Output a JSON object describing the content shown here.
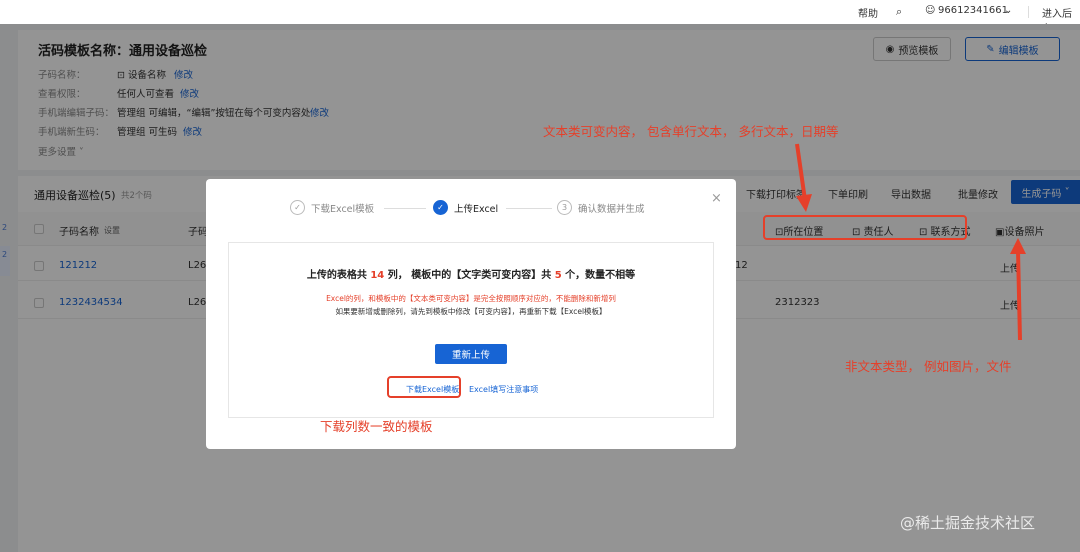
{
  "topbar": {
    "help": "帮助",
    "phone": "96612341661",
    "enter": "进入后台"
  },
  "header": {
    "title": "活码模板名称：通用设备巡检",
    "preview_label": "预览模板",
    "edit_label": "编辑模板",
    "rows": [
      {
        "label": "子码名称：",
        "value": "⊡ 设备名称",
        "link": "修改"
      },
      {
        "label": "查看权限：",
        "value": "任何人可查看",
        "link": "修改"
      },
      {
        "label": "手机端编辑子码：",
        "value": "管理组 可编辑，“编辑”按钮在每个可变内容处",
        "link": "修改"
      },
      {
        "label": "手机端新生码：",
        "value": "管理组 可生码",
        "link": "修改"
      }
    ],
    "more": "更多设置 ˅"
  },
  "list": {
    "title": "通用设备巡检(5)",
    "count": "共2个码",
    "toolbar": [
      "下载打印标签",
      "下单印刷",
      "导出数据",
      "批量修改"
    ],
    "generate": "生成子码",
    "columns": {
      "name": "子码名称",
      "settings": "设置",
      "col2": "子码",
      "location": "⊡所在位置",
      "owner": "⊡ 责任人",
      "contact": "⊡ 联系方式",
      "photo": "▣设备照片"
    },
    "rows": [
      {
        "name": "121212",
        "col2": "L26",
        "tail": "12",
        "photo": "上传"
      },
      {
        "name": "1232434534",
        "col2": "L26",
        "tail": "2312323",
        "photo": "上传"
      }
    ],
    "left_nums": [
      "2",
      "2"
    ]
  },
  "modal": {
    "steps": [
      {
        "num": "✓",
        "label": "下载Excel模板"
      },
      {
        "num": "✓",
        "label": "上传Excel"
      },
      {
        "num": "3",
        "label": "确认数据并生成"
      }
    ],
    "close": "×",
    "msg_prefix": "上传的表格共 ",
    "msg_cols": "14",
    "msg_mid": " 列， 模板中的【文字类可变内容】共 ",
    "msg_vars": "5",
    "msg_suffix": " 个，数量不相等",
    "warning": "Excel的列，和模板中的【文本类可变内容】是完全按照顺序对应的，不能删除和新增列",
    "info": "如果要新增或删除列，请先到模板中修改【可变内容】，再重新下载【Excel模板】",
    "reupload": "重新上传",
    "download_template": "下载Excel模板",
    "fill_notes": "Excel填写注意事项"
  },
  "annotations": {
    "text_types": "文本类可变内容， 包含单行文本， 多行文本，日期等",
    "non_text": "非文本类型， 例如图片，文件",
    "download_hint": "下载列数一致的模板"
  },
  "watermark": "@稀土掘金技术社区",
  "colors": {
    "primary": "#1764d4",
    "annotation": "#e5402a",
    "overlay": "rgba(0,0,0,0.42)"
  }
}
